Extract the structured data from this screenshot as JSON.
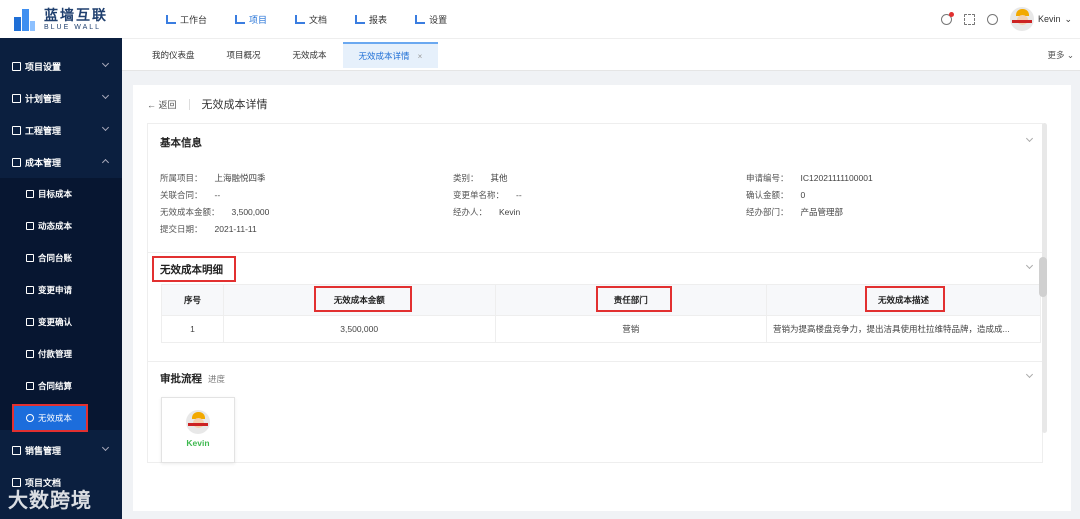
{
  "brand": {
    "name_cn": "蓝墙互联",
    "name_en": "BLUE WALL"
  },
  "top_nav": [
    {
      "label": "工作台",
      "icon": "workbench-icon"
    },
    {
      "label": "项目",
      "icon": "project-icon",
      "active": true
    },
    {
      "label": "文档",
      "icon": "document-icon"
    },
    {
      "label": "报表",
      "icon": "report-icon"
    },
    {
      "label": "设置",
      "icon": "settings-icon"
    }
  ],
  "user": {
    "name": "Kevin"
  },
  "tabs": [
    {
      "label": "我的仪表盘"
    },
    {
      "label": "项目概况"
    },
    {
      "label": "无效成本"
    },
    {
      "label": "无效成本详情",
      "active": true,
      "close": "×"
    }
  ],
  "more_label": "更多",
  "sidebar": {
    "items": [
      {
        "label": "项目设置"
      },
      {
        "label": "计划管理"
      },
      {
        "label": "工程管理"
      },
      {
        "label": "成本管理",
        "expanded": true
      }
    ],
    "sub_items": [
      {
        "label": "目标成本"
      },
      {
        "label": "动态成本"
      },
      {
        "label": "合同台账"
      },
      {
        "label": "变更申请"
      },
      {
        "label": "变更确认"
      },
      {
        "label": "付款管理"
      },
      {
        "label": "合同结算"
      },
      {
        "label": "无效成本",
        "active": true
      }
    ],
    "after_items": [
      {
        "label": "销售管理"
      },
      {
        "label": "项目文档"
      }
    ]
  },
  "watermark": "大数跨境",
  "page": {
    "back_label": "返回",
    "title": "无效成本详情"
  },
  "basic_info": {
    "title": "基本信息",
    "fields": {
      "project_label": "所属项目：",
      "project_value": "上海融悦四季",
      "category_label": "类别：",
      "category_value": "其他",
      "apply_no_label": "申请编号：",
      "apply_no_value": "IC12021111100001",
      "contract_label": "关联合同：",
      "contract_value": "--",
      "change_name_label": "变更单名称：",
      "change_name_value": "--",
      "confirm_amount_label": "确认金额：",
      "confirm_amount_value": "0",
      "amount_label": "无效成本金额：",
      "amount_value": "3,500,000",
      "handler_label": "经办人：",
      "handler_value": "Kevin",
      "dept_label": "经办部门：",
      "dept_value": "产品管理部",
      "date_label": "提交日期：",
      "date_value": "2021-11-11"
    }
  },
  "detail": {
    "title": "无效成本明细",
    "columns": [
      "序号",
      "无效成本金额",
      "责任部门",
      "无效成本描述"
    ],
    "rows": [
      {
        "no": "1",
        "amount": "3,500,000",
        "dept": "营销",
        "desc": "营销为提高楼盘竞争力，提出洁具使用杜拉维特品牌，造成成..."
      }
    ]
  },
  "approval": {
    "title": "审批流程",
    "link": "进度",
    "approver": "Kevin"
  }
}
